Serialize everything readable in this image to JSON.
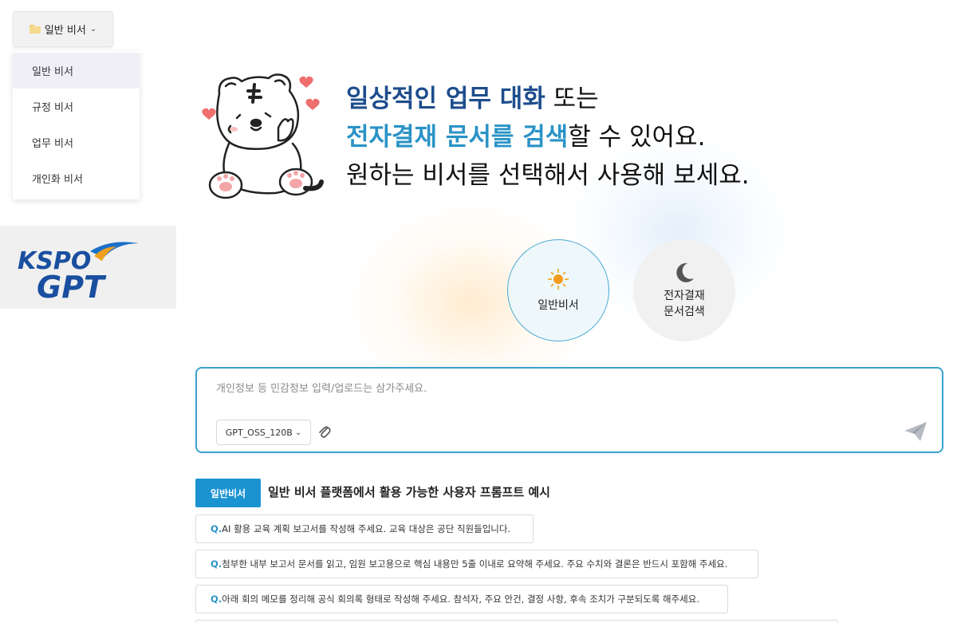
{
  "assistant_select": {
    "label": "일반 비서",
    "icon": "folder-icon"
  },
  "dropdown": {
    "items": [
      {
        "label": "일반 비서",
        "active": true
      },
      {
        "label": "규정 비서",
        "active": false
      },
      {
        "label": "업무 비서",
        "active": false
      },
      {
        "label": "개인화 비서",
        "active": false
      }
    ]
  },
  "logo": {
    "line1": "KSPO",
    "line2": "GPT"
  },
  "hero": {
    "line1_highlight": "일상적인 업무 대화",
    "line1_rest": " 또는",
    "line2_highlight": "전자결재 문서를 검색",
    "line2_rest": "할 수 있어요.",
    "line3": "원하는 비서를 선택해서 사용해 보세요."
  },
  "modes": {
    "general": {
      "label": "일반비서",
      "icon": "sun-icon"
    },
    "approval": {
      "label_line1": "전자결재",
      "label_line2": "문서검색",
      "icon": "moon-icon"
    }
  },
  "chat": {
    "placeholder": "개인정보 등 민감정보 입력/업로드는 삼가주세요.",
    "model": "GPT_OSS_120B"
  },
  "examples": {
    "badge": "일반비서",
    "title": "일반 비서 플랫폼에서 활용 가능한 사용자 프롬프트 예시",
    "q_prefix": "Q.",
    "items": [
      "AI 활용 교육 계획 보고서를 작성해 주세요. 교육 대상은 공단 직원들입니다.",
      "첨부한 내부 보고서 문서를 읽고, 임원 보고용으로 핵심 내용만 5줄 이내로 요약해 주세요. 주요 수치와 결론은 반드시 포함해 주세요.",
      "아래 회의 메모를 정리해 공식 회의록 형태로 작성해 주세요. 참석자, 주요 안건, 결정 사항, 후속 조치가 구분되도록 해주세요."
    ]
  },
  "colors": {
    "accent": "#1b93d1",
    "border_active": "#3aa0cc",
    "hero_navy": "#1d4d8c",
    "hero_cyan": "#2a93c6",
    "logo_blue": "#1a4fa0"
  }
}
